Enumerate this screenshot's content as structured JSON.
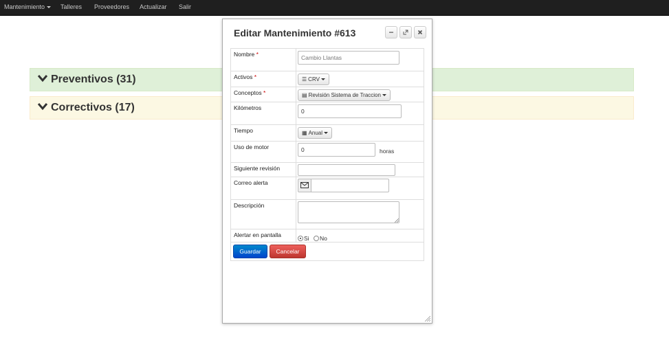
{
  "navbar": {
    "items": [
      {
        "label": "Mantenimiento"
      },
      {
        "label": "Talleres"
      },
      {
        "label": "Proveedores"
      },
      {
        "label": "Actualizar"
      },
      {
        "label": "Salir"
      }
    ]
  },
  "sections": {
    "preventivos": "Preventivos (31)",
    "correctivos": "Correctivos (17)"
  },
  "dialog": {
    "title": "Editar Mantenimiento #613",
    "fields": {
      "nombre": {
        "label": "Nombre",
        "required_mark": "*",
        "placeholder": "Cambio Llantas"
      },
      "activos": {
        "label": "Activos",
        "required_mark": "*",
        "value": "CRV"
      },
      "conceptos": {
        "label": "Conceptos",
        "required_mark": "*",
        "value": "Revisión Sistema de Traccion"
      },
      "kilometros": {
        "label": "Kilómetros",
        "value": "0"
      },
      "tiempo": {
        "label": "Tiempo",
        "value": "Anual"
      },
      "uso_motor": {
        "label": "Uso de motor",
        "value": "0",
        "suffix": "horas"
      },
      "siguiente_revision": {
        "label": "Siguiente revisión",
        "value": ""
      },
      "correo_alerta": {
        "label": "Correo alerta",
        "value": ""
      },
      "descripcion": {
        "label": "Descripción",
        "value": ""
      },
      "alertar": {
        "label": "Alertar en pantalla",
        "options": [
          "Si",
          "No"
        ],
        "selected": "Si"
      }
    },
    "buttons": {
      "save": "Guardar",
      "cancel": "Cancelar"
    }
  },
  "icons": {
    "chevron": "chevron-down-icon",
    "minimize": "minimize-icon",
    "restore": "restore-icon",
    "close": "close-icon",
    "list": "list-icon",
    "card": "card-icon",
    "calendar": "calendar-icon",
    "envelope": "envelope-icon"
  },
  "colors": {
    "navbar": "#1f1f1f",
    "success_bg": "#dff0d8",
    "warning_bg": "#fcf8e3",
    "primary": "#0055cc",
    "danger": "#d9534f"
  }
}
